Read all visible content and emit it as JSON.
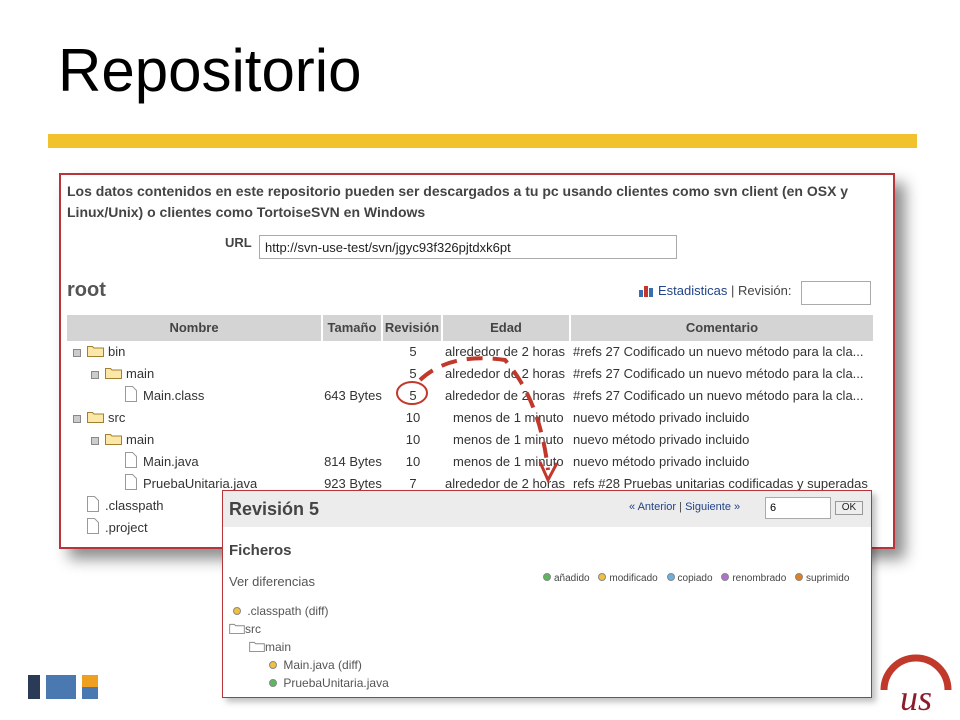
{
  "slide": {
    "title": "Repositorio"
  },
  "repo": {
    "intro": "Los datos contenidos en este repositorio pueden ser descargados a tu pc usando clientes como svn client (en OSX y Linux/Unix) o clientes como TortoiseSVN en Windows",
    "url_label": "URL",
    "url_value": "http://svn-use-test/svn/jgyc93f326pjtdxk6pt",
    "root_title": "root",
    "stats_link": "Estadisticas",
    "stats_sep": " | ",
    "revision_label": "Revisión:",
    "columns": [
      "Nombre",
      "Tamaño",
      "Revisión",
      "Edad",
      "Comentario"
    ],
    "rows": [
      {
        "name": "bin",
        "size": "",
        "rev": "5",
        "age": "alrededor de 2 horas",
        "comment": "#refs 27 Codificado un nuevo método para la cla..."
      },
      {
        "name": "main",
        "size": "",
        "rev": "5",
        "age": "alrededor de 2 horas",
        "comment": "#refs 27 Codificado un nuevo método para la cla..."
      },
      {
        "name": "Main.class",
        "size": "643 Bytes",
        "rev": "5",
        "age": "alrededor de 2 horas",
        "comment": "#refs 27 Codificado un nuevo método para la cla..."
      },
      {
        "name": "src",
        "size": "",
        "rev": "10",
        "age": "menos de 1 minuto",
        "comment": "nuevo método privado incluido"
      },
      {
        "name": "main",
        "size": "",
        "rev": "10",
        "age": "menos de 1 minuto",
        "comment": "nuevo método privado incluido"
      },
      {
        "name": "Main.java",
        "size": "814 Bytes",
        "rev": "10",
        "age": "menos de 1 minuto",
        "comment": "nuevo método privado incluido"
      },
      {
        "name": "PruebaUnitaria.java",
        "size": "923 Bytes",
        "rev": "7",
        "age": "alrededor de 2 horas",
        "comment": "refs #28 Pruebas unitarias codificadas y superadas"
      },
      {
        "name": ".classpath",
        "size": "",
        "rev": "",
        "age": "",
        "comment": ""
      },
      {
        "name": ".project",
        "size": "",
        "rev": "",
        "age": "",
        "comment": ""
      }
    ]
  },
  "revision": {
    "title": "Revisión 5",
    "nav_prev": "« Anterior",
    "nav_sep": " | ",
    "nav_next": "Siguiente »",
    "input_value": "6",
    "ok_label": "OK",
    "files_heading": "Ficheros",
    "view_diffs": "Ver diferencias",
    "legend": [
      "añadido",
      "modificado",
      "copiado",
      "renombrado",
      "suprimido"
    ],
    "legend_colors": [
      "#5cb85c",
      "#f0c040",
      "#6ab0e0",
      "#b070d0",
      "#e08020"
    ],
    "changes": [
      {
        "label": ".classpath (diff)"
      },
      {
        "label": "src"
      },
      {
        "label": "main"
      },
      {
        "label": "Main.java (diff)"
      },
      {
        "label": "PruebaUnitaria.java"
      }
    ]
  },
  "colors": {
    "title_bar": "#f2c12e",
    "panel_border": "#b8343b",
    "annotation": "#c0392b"
  },
  "icons": [
    "expand-toggle-icon",
    "folder-icon",
    "file-icon",
    "bar-chart-icon",
    "status-dot-icon",
    "university-seal-icon"
  ]
}
